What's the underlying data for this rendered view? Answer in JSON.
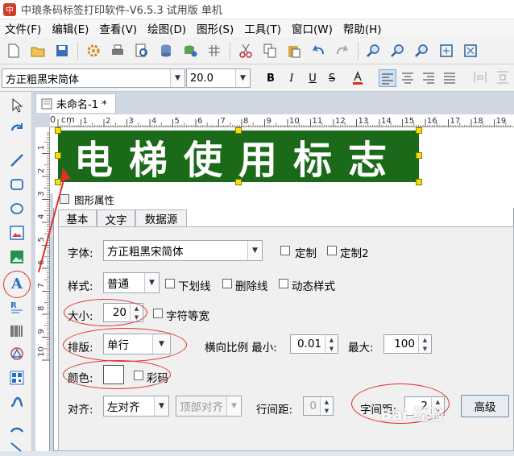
{
  "window": {
    "title": "中琅条码标签打印软件-V6.5.3 试用版 单机"
  },
  "menu": [
    "文件(F)",
    "编辑(E)",
    "查看(V)",
    "绘图(D)",
    "图形(S)",
    "工具(T)",
    "窗口(W)",
    "帮助(H)"
  ],
  "format_bar": {
    "font_name": "方正粗黑宋简体",
    "font_size": "20.0",
    "bold": "B",
    "italic": "I",
    "underline": "U",
    "strike": "S"
  },
  "document": {
    "tab_title": "未命名-1 *",
    "label_text": "电梯使用标志",
    "ruler_unit": "cm",
    "h_ticks": [
      "0",
      "1",
      "2",
      "3",
      "4",
      "5",
      "6",
      "7",
      "8",
      "9",
      "10",
      "11",
      "12",
      "13",
      "14",
      "15",
      "16",
      "17",
      "18",
      "19"
    ],
    "v_ticks": [
      "1",
      "2",
      "3",
      "4",
      "5",
      "6",
      "7",
      "8",
      "9",
      "10"
    ]
  },
  "dialog": {
    "title": "图形属性",
    "tabs": [
      "基本",
      "文字",
      "数据源"
    ],
    "font_label": "字体:",
    "font_value": "方正粗黑宋简体",
    "custom1": "定制",
    "custom2": "定制2",
    "style_label": "样式:",
    "style_value": "普通",
    "underline": "下划线",
    "strikethrough": "删除线",
    "dynamic_style": "动态样式",
    "size_label": "大小:",
    "size_value": "20",
    "equal_width": "字符等宽",
    "layout_label": "排版:",
    "layout_value": "单行",
    "h_ratio_label": "横向比例 最小:",
    "h_ratio_min": "0.01",
    "max_label": "最大:",
    "max_value": "100",
    "color_label": "颜色:",
    "color_value": "#ffffff",
    "rainbow": "彩码",
    "align_label": "对齐:",
    "align_value": "左对齐",
    "valign_value": "顶部对齐",
    "line_spacing_label": "行间距:",
    "line_spacing_value": "0",
    "char_spacing_label": "字间距:",
    "char_spacing_value": "2",
    "advanced": "高级"
  },
  "watermark": "Bai 经验",
  "colors": {
    "label_bg": "#1a6a1a",
    "annotation": "#e0302a",
    "handle": "#f5e000"
  }
}
